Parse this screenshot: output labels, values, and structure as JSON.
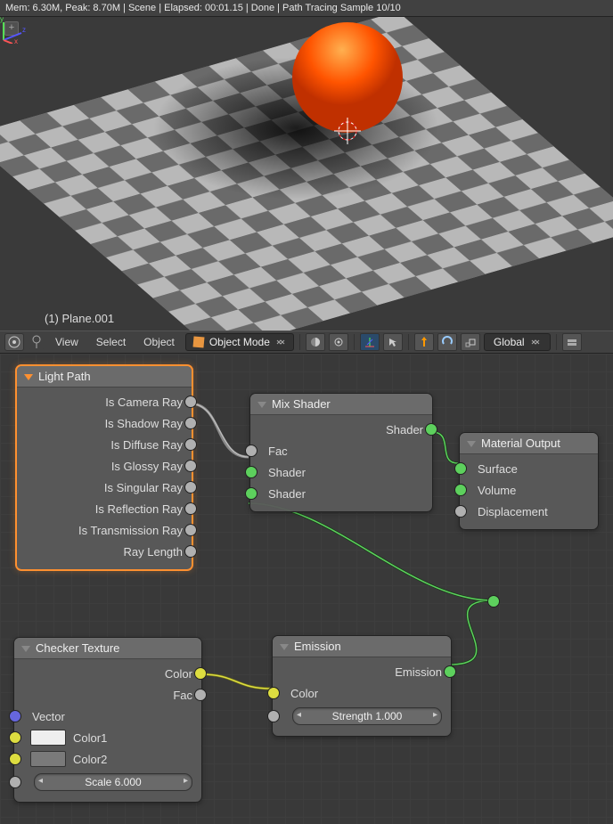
{
  "statusbar": "Mem: 6.30M, Peak: 8.70M | Scene | Elapsed: 00:01.15 | Done | Path Tracing Sample 10/10",
  "viewport": {
    "object_label": "(1) Plane.001",
    "add_icon": "+"
  },
  "header": {
    "menu_view": "View",
    "menu_select": "Select",
    "menu_object": "Object",
    "mode": "Object Mode",
    "orientation": "Global"
  },
  "nodes": {
    "light_path": {
      "title": "Light Path",
      "outputs": [
        "Is Camera Ray",
        "Is Shadow Ray",
        "Is Diffuse Ray",
        "Is Glossy Ray",
        "Is Singular Ray",
        "Is Reflection Ray",
        "Is Transmission Ray",
        "Ray Length"
      ]
    },
    "mix_shader": {
      "title": "Mix Shader",
      "out": "Shader",
      "in_fac": "Fac",
      "in_shader1": "Shader",
      "in_shader2": "Shader"
    },
    "material_output": {
      "title": "Material Output",
      "surface": "Surface",
      "volume": "Volume",
      "displacement": "Displacement"
    },
    "checker": {
      "title": "Checker Texture",
      "out_color": "Color",
      "out_fac": "Fac",
      "in_vector": "Vector",
      "in_color1": "Color1",
      "in_color2": "Color2",
      "scale": "Scale 6.000"
    },
    "emission": {
      "title": "Emission",
      "out": "Emission",
      "in_color": "Color",
      "strength": "Strength 1.000"
    }
  }
}
